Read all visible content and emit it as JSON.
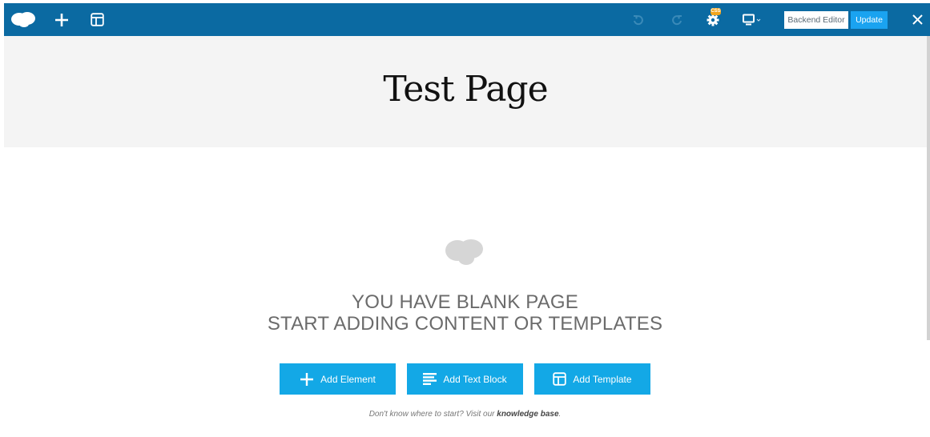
{
  "toolbar": {
    "logo_icon": "cloud-logo-icon",
    "add_icon": "plus-icon",
    "templates_icon": "template-icon",
    "undo_icon": "undo-icon",
    "redo_icon": "redo-icon",
    "settings_icon": "gear-icon",
    "css_badge": "CSS",
    "responsive_icon": "monitor-icon",
    "backend_editor_label": "Backend Editor",
    "update_label": "Update",
    "close_icon": "close-icon"
  },
  "page": {
    "title": "Test Page"
  },
  "blank_state": {
    "line1": "YOU HAVE BLANK PAGE",
    "line2": "START ADDING CONTENT OR TEMPLATES",
    "buttons": [
      {
        "label": "Add Element",
        "icon": "plus-icon"
      },
      {
        "label": "Add Text Block",
        "icon": "text-lines-icon"
      },
      {
        "label": "Add Template",
        "icon": "template-icon"
      }
    ],
    "help_prefix": "Don't know where to start? Visit our ",
    "help_link": "knowledge base",
    "help_suffix": "."
  },
  "colors": {
    "toolbar_bg": "#0b6aa2",
    "accent": "#13a8e6",
    "update_bg": "#1aa3f0",
    "badge": "#f2a51d"
  }
}
